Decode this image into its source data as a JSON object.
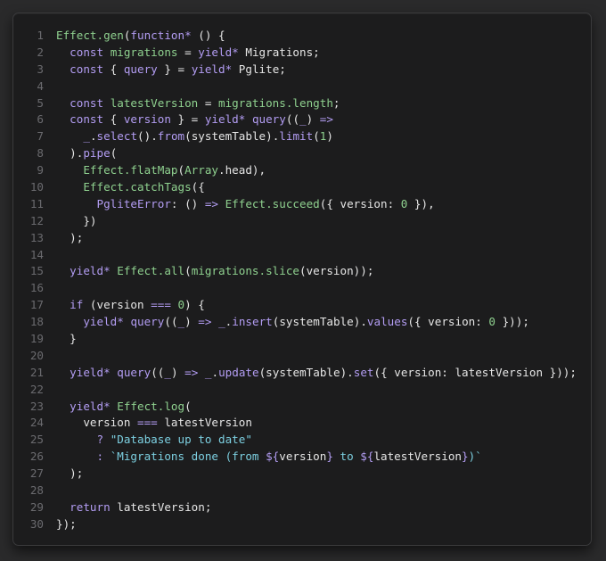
{
  "code": {
    "lines": [
      {
        "n": "1",
        "tokens": [
          [
            "fn",
            "Effect.gen"
          ],
          [
            "p",
            "("
          ],
          [
            "kw",
            "function*"
          ],
          [
            "p",
            " () {"
          ]
        ]
      },
      {
        "n": "2",
        "tokens": [
          [
            "p",
            "  "
          ],
          [
            "kw",
            "const"
          ],
          [
            "p",
            " "
          ],
          [
            "fn",
            "migrations"
          ],
          [
            "p",
            " = "
          ],
          [
            "kw",
            "yield*"
          ],
          [
            "p",
            " "
          ],
          [
            "id",
            "Migrations;"
          ]
        ]
      },
      {
        "n": "3",
        "tokens": [
          [
            "p",
            "  "
          ],
          [
            "kw",
            "const"
          ],
          [
            "p",
            " { "
          ],
          [
            "kw",
            "query"
          ],
          [
            "p",
            " } = "
          ],
          [
            "kw",
            "yield*"
          ],
          [
            "p",
            " "
          ],
          [
            "id",
            "Pglite;"
          ]
        ]
      },
      {
        "n": "4",
        "tokens": []
      },
      {
        "n": "5",
        "tokens": [
          [
            "p",
            "  "
          ],
          [
            "kw",
            "const"
          ],
          [
            "p",
            " "
          ],
          [
            "fn",
            "latestVersion"
          ],
          [
            "p",
            " = "
          ],
          [
            "fn",
            "migrations.length"
          ],
          [
            "p",
            ";"
          ]
        ]
      },
      {
        "n": "6",
        "tokens": [
          [
            "p",
            "  "
          ],
          [
            "kw",
            "const"
          ],
          [
            "p",
            " { "
          ],
          [
            "kw",
            "version"
          ],
          [
            "p",
            " } = "
          ],
          [
            "kw",
            "yield*"
          ],
          [
            "p",
            " "
          ],
          [
            "kw",
            "query"
          ],
          [
            "p",
            "(("
          ],
          [
            "kw",
            "_"
          ],
          [
            "p",
            ") "
          ],
          [
            "kw",
            "=>"
          ]
        ]
      },
      {
        "n": "7",
        "tokens": [
          [
            "p",
            "    "
          ],
          [
            "kw",
            "_"
          ],
          [
            "p",
            "."
          ],
          [
            "kw",
            "select"
          ],
          [
            "p",
            "()."
          ],
          [
            "kw",
            "from"
          ],
          [
            "p",
            "(systemTable)."
          ],
          [
            "kw",
            "limit"
          ],
          [
            "p",
            "("
          ],
          [
            "num",
            "1"
          ],
          [
            "p",
            ")"
          ]
        ]
      },
      {
        "n": "8",
        "tokens": [
          [
            "p",
            "  )."
          ],
          [
            "kw",
            "pipe"
          ],
          [
            "p",
            "("
          ]
        ]
      },
      {
        "n": "9",
        "tokens": [
          [
            "p",
            "    "
          ],
          [
            "fn",
            "Effect.flatMap"
          ],
          [
            "p",
            "("
          ],
          [
            "fn",
            "Array"
          ],
          [
            "p",
            ".head),"
          ]
        ]
      },
      {
        "n": "10",
        "tokens": [
          [
            "p",
            "    "
          ],
          [
            "fn",
            "Effect.catchTags"
          ],
          [
            "p",
            "({"
          ]
        ]
      },
      {
        "n": "11",
        "tokens": [
          [
            "p",
            "      "
          ],
          [
            "kw",
            "PgliteError"
          ],
          [
            "p",
            ": () "
          ],
          [
            "kw",
            "=>"
          ],
          [
            "p",
            " "
          ],
          [
            "fn",
            "Effect.succeed"
          ],
          [
            "p",
            "({ version: "
          ],
          [
            "num",
            "0"
          ],
          [
            "p",
            " }),"
          ]
        ]
      },
      {
        "n": "12",
        "tokens": [
          [
            "p",
            "    })"
          ]
        ]
      },
      {
        "n": "13",
        "tokens": [
          [
            "p",
            "  );"
          ]
        ]
      },
      {
        "n": "14",
        "tokens": []
      },
      {
        "n": "15",
        "tokens": [
          [
            "p",
            "  "
          ],
          [
            "kw",
            "yield*"
          ],
          [
            "p",
            " "
          ],
          [
            "fn",
            "Effect.all"
          ],
          [
            "p",
            "("
          ],
          [
            "fn",
            "migrations.slice"
          ],
          [
            "p",
            "(version));"
          ]
        ]
      },
      {
        "n": "16",
        "tokens": []
      },
      {
        "n": "17",
        "tokens": [
          [
            "p",
            "  "
          ],
          [
            "kw",
            "if"
          ],
          [
            "p",
            " (version "
          ],
          [
            "kw",
            "==="
          ],
          [
            "p",
            " "
          ],
          [
            "num",
            "0"
          ],
          [
            "p",
            ") {"
          ]
        ]
      },
      {
        "n": "18",
        "tokens": [
          [
            "p",
            "    "
          ],
          [
            "kw",
            "yield*"
          ],
          [
            "p",
            " "
          ],
          [
            "kw",
            "query"
          ],
          [
            "p",
            "(("
          ],
          [
            "kw",
            "_"
          ],
          [
            "p",
            ") "
          ],
          [
            "kw",
            "=>"
          ],
          [
            "p",
            " "
          ],
          [
            "kw",
            "_"
          ],
          [
            "p",
            "."
          ],
          [
            "kw",
            "insert"
          ],
          [
            "p",
            "(systemTable)."
          ],
          [
            "kw",
            "values"
          ],
          [
            "p",
            "({ version: "
          ],
          [
            "num",
            "0"
          ],
          [
            "p",
            " }));"
          ]
        ]
      },
      {
        "n": "19",
        "tokens": [
          [
            "p",
            "  }"
          ]
        ]
      },
      {
        "n": "20",
        "tokens": []
      },
      {
        "n": "21",
        "tokens": [
          [
            "p",
            "  "
          ],
          [
            "kw",
            "yield*"
          ],
          [
            "p",
            " "
          ],
          [
            "kw",
            "query"
          ],
          [
            "p",
            "(("
          ],
          [
            "kw",
            "_"
          ],
          [
            "p",
            ") "
          ],
          [
            "kw",
            "=>"
          ],
          [
            "p",
            " "
          ],
          [
            "kw",
            "_"
          ],
          [
            "p",
            "."
          ],
          [
            "kw",
            "update"
          ],
          [
            "p",
            "(systemTable)."
          ],
          [
            "kw",
            "set"
          ],
          [
            "p",
            "({ version: latestVersion }));"
          ]
        ]
      },
      {
        "n": "22",
        "tokens": []
      },
      {
        "n": "23",
        "tokens": [
          [
            "p",
            "  "
          ],
          [
            "kw",
            "yield*"
          ],
          [
            "p",
            " "
          ],
          [
            "fn",
            "Effect.log"
          ],
          [
            "p",
            "("
          ]
        ]
      },
      {
        "n": "24",
        "tokens": [
          [
            "p",
            "    version "
          ],
          [
            "kw",
            "==="
          ],
          [
            "p",
            " latestVersion"
          ]
        ]
      },
      {
        "n": "25",
        "tokens": [
          [
            "p",
            "      "
          ],
          [
            "kw",
            "?"
          ],
          [
            "p",
            " "
          ],
          [
            "str",
            "\"Database up to date\""
          ]
        ]
      },
      {
        "n": "26",
        "tokens": [
          [
            "p",
            "      "
          ],
          [
            "kw",
            ":"
          ],
          [
            "p",
            " "
          ],
          [
            "str",
            "`Migrations done (from "
          ],
          [
            "kw",
            "${"
          ],
          [
            "p",
            "version"
          ],
          [
            "kw",
            "}"
          ],
          [
            "str",
            " to "
          ],
          [
            "kw",
            "${"
          ],
          [
            "p",
            "latestVersion"
          ],
          [
            "kw",
            "}"
          ],
          [
            "str",
            ")`"
          ]
        ]
      },
      {
        "n": "27",
        "tokens": [
          [
            "p",
            "  );"
          ]
        ]
      },
      {
        "n": "28",
        "tokens": []
      },
      {
        "n": "29",
        "tokens": [
          [
            "p",
            "  "
          ],
          [
            "kw",
            "return"
          ],
          [
            "p",
            " latestVersion;"
          ]
        ]
      },
      {
        "n": "30",
        "tokens": [
          [
            "p",
            "});"
          ]
        ]
      }
    ]
  },
  "colors": {
    "background": "#2a2a2b",
    "panel": "#1c1c1d",
    "keyword": "#b39df3",
    "function": "#8fd18f",
    "number": "#8fd18f",
    "string": "#7ccfe0",
    "text": "#e6e6e6",
    "line_number": "#6a6a6e"
  }
}
